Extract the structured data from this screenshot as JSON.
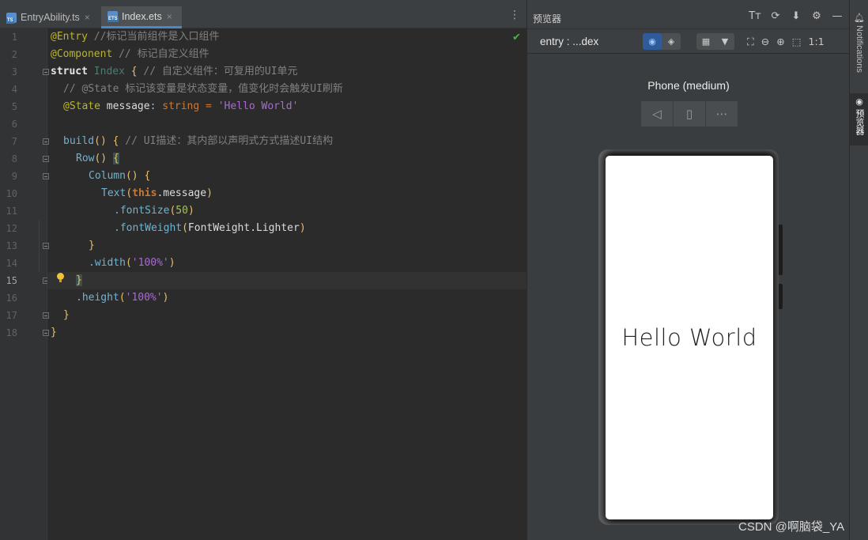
{
  "editor": {
    "tabs": [
      {
        "label": "EntryAbility.ts",
        "type": "TS"
      },
      {
        "label": "Index.ets",
        "type": "ETS"
      }
    ],
    "line_numbers": [
      "1",
      "2",
      "3",
      "4",
      "5",
      "6",
      "7",
      "8",
      "9",
      "10",
      "11",
      "12",
      "13",
      "14",
      "15",
      "16",
      "17",
      "18"
    ],
    "current_line": "15",
    "code": {
      "l1_ann": "@Entry",
      "l1_cm": "//标记当前组件是入口组件",
      "l2_ann": "@Component",
      "l2_cm": "// 标记自定义组件",
      "l3_kw": "struct",
      "l3_cls": "Index",
      "l3_br": "{",
      "l3_cm": "// 自定义组件：可复用的UI单元",
      "l4_cm": "// @State 标记该变量是状态变量，值变化时会触发UI刷新",
      "l5_ann": "@State",
      "l5_name": "message",
      "l5_colon": ":",
      "l5_type": "string",
      "l5_eq": "=",
      "l5_str": "'Hello World'",
      "l7_fn": "build",
      "l7_paren": "()",
      "l7_br": "{",
      "l7_cm": "// UI描述：其内部以声明式方式描述UI结构",
      "l8_fn": "Row",
      "l8_paren": "()",
      "l8_br": "{",
      "l9_fn": "Column",
      "l9_paren": "()",
      "l9_br": "{",
      "l10_fn": "Text",
      "l10_open": "(",
      "l10_this": "this",
      "l10_rest": ".message",
      "l10_close": ")",
      "l11_fn": ".fontSize",
      "l11_open": "(",
      "l11_num": "50",
      "l11_close": ")",
      "l12_fn": ".fontWeight",
      "l12_open": "(",
      "l12_arg": "FontWeight.Lighter",
      "l12_close": ")",
      "l13_br": "}",
      "l14_fn": ".width",
      "l14_open": "(",
      "l14_str": "'100%'",
      "l14_close": ")",
      "l15_br": "}",
      "l16_fn": ".height",
      "l16_open": "(",
      "l16_str": "'100%'",
      "l16_close": ")",
      "l17_br": "}",
      "l18_br": "}"
    },
    "icons": {
      "check": "✔",
      "more": "⋮",
      "close": "×"
    }
  },
  "preview": {
    "title": "预览器",
    "entry": "entry : ...dex",
    "device_name": "Phone (medium)",
    "screen_text": "Hello World",
    "toolbar_icons": [
      "Tт",
      "⟳",
      "⬇",
      "⚙",
      "—"
    ],
    "zoom_icons": [
      "⛶",
      "⊖",
      "⊕",
      "⬚",
      "1:1"
    ],
    "device_tools": [
      "◁",
      "▯",
      "⋯"
    ]
  },
  "strip": {
    "notifications": "Notifications",
    "previewer": "预览器"
  },
  "watermark": "CSDN @啊脑袋_YA"
}
